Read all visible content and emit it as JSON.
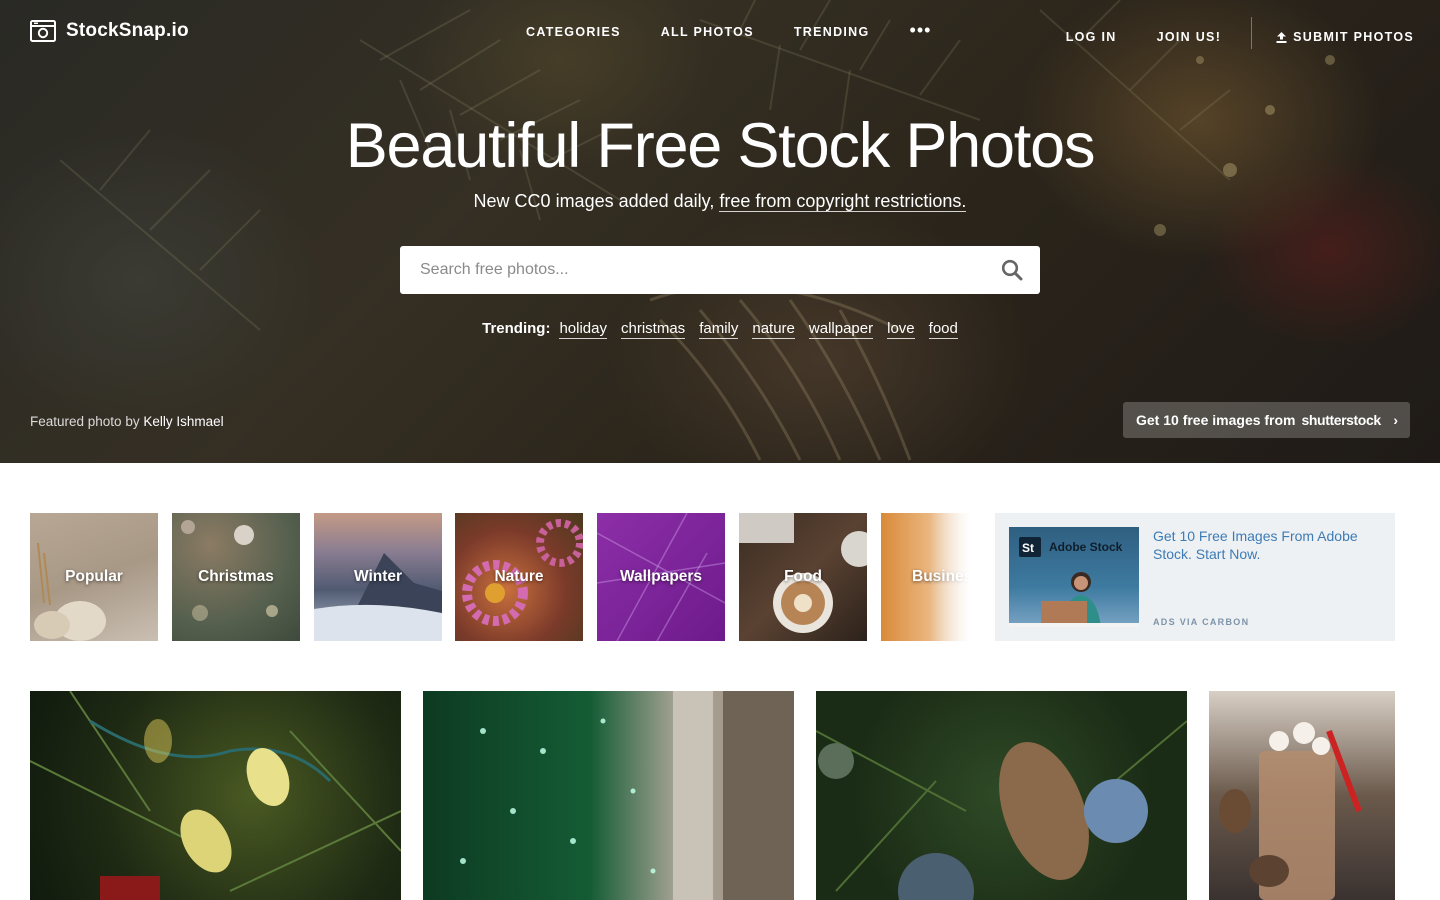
{
  "site": {
    "logo_text": "StockSnap.io"
  },
  "nav": {
    "categories": "CATEGORIES",
    "all_photos": "ALL PHOTOS",
    "trending": "TRENDING",
    "more": "•••",
    "log_in": "LOG IN",
    "join": "JOIN US!",
    "submit": "SUBMIT PHOTOS"
  },
  "hero": {
    "title": "Beautiful Free Stock Photos",
    "subtitle_prefix": "New CC0 images added daily,",
    "subtitle_link": "free from copyright restrictions.",
    "search_placeholder": "Search free photos...",
    "trending_label": "Trending:",
    "trending_tags": [
      "holiday",
      "christmas",
      "family",
      "nature",
      "wallpaper",
      "love",
      "food"
    ],
    "featured_prefix": "Featured photo by",
    "featured_author": "Kelly Ishmael",
    "promo_text": "Get 10 free images from",
    "promo_brand": "shutterstock",
    "promo_chevron": "›"
  },
  "categories": [
    "Popular",
    "Christmas",
    "Winter",
    "Nature",
    "Wallpapers",
    "Food",
    "Business"
  ],
  "ad": {
    "badge": "St",
    "brand": "Adobe Stock",
    "text": "Get 10 Free Images From Adobe Stock. Start Now.",
    "via": "ADS VIA CARBON"
  },
  "icons": {
    "logo": "camera-icon",
    "search": "search-icon",
    "upload": "upload-icon",
    "chevron": "chevron-right-icon"
  },
  "colors": {
    "ad_link": "#3d7bb4",
    "ad_background": "#eef1f4",
    "white": "#ffffff"
  }
}
